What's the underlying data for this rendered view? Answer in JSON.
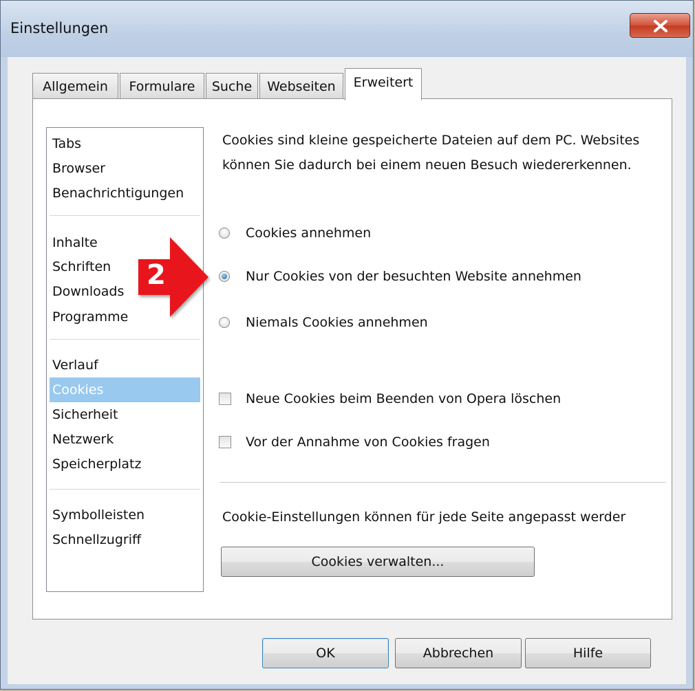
{
  "window": {
    "title": "Einstellungen"
  },
  "tabs": [
    {
      "label": "Allgemein"
    },
    {
      "label": "Formulare"
    },
    {
      "label": "Suche"
    },
    {
      "label": "Webseiten"
    },
    {
      "label": "Erweitert",
      "active": true
    }
  ],
  "sidebar": {
    "groups": [
      [
        "Tabs",
        "Browser",
        "Benachrichtigungen"
      ],
      [
        "Inhalte",
        "Schriften",
        "Downloads",
        "Programme"
      ],
      [
        "Verlauf",
        "Cookies",
        "Sicherheit",
        "Netzwerk",
        "Speicherplatz"
      ],
      [
        "Symbolleisten",
        "Schnellzugriff"
      ]
    ],
    "selected": "Cookies"
  },
  "content": {
    "description": "Cookies sind kleine gespeicherte Dateien auf dem PC. Websites können Sie dadurch bei einem neuen Besuch wiedererkennen.",
    "radio_options": [
      {
        "label": "Cookies annehmen",
        "checked": false
      },
      {
        "label": "Nur Cookies von der besuchten Website annehmen",
        "checked": true
      },
      {
        "label": "Niemals Cookies annehmen",
        "checked": false
      }
    ],
    "checkboxes": [
      {
        "label": "Neue Cookies beim Beenden von Opera löschen",
        "checked": false
      },
      {
        "label": "Vor der Annahme von Cookies fragen",
        "checked": false
      }
    ],
    "info": "Cookie-Einstellungen können für jede Seite angepasst werder",
    "manage_button": "Cookies verwalten..."
  },
  "buttons": {
    "ok": "OK",
    "cancel": "Abbrechen",
    "help": "Hilfe"
  },
  "annotation": {
    "number": "2",
    "color": "#e8141c",
    "icon": "red-arrow-icon"
  },
  "colors": {
    "selection": "#99c9ef",
    "close_button": "#c43b22"
  }
}
